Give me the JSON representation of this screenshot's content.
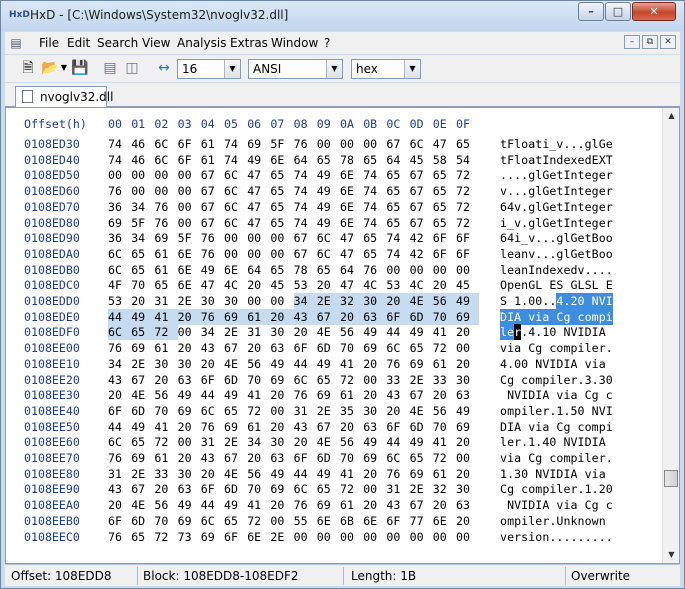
{
  "window": {
    "title": "HxD - [C:\\Windows\\System32\\nvoglv32.dll]",
    "app_icon": "HxD",
    "min": "–",
    "max": "□",
    "close": "✕"
  },
  "menu": {
    "items": [
      "File",
      "Edit",
      "Search",
      "View",
      "Analysis",
      "Extras",
      "Window",
      "?"
    ]
  },
  "toolbar": {
    "bytes_per_row": "16",
    "charset": "ANSI",
    "offset_base": "hex"
  },
  "tab": {
    "label": "nvoglv32.dll"
  },
  "editor": {
    "header_offset": "Offset(h)",
    "header_bytes": [
      "00",
      "01",
      "02",
      "03",
      "04",
      "05",
      "06",
      "07",
      "08",
      "09",
      "0A",
      "0B",
      "0C",
      "0D",
      "0E",
      "0F"
    ],
    "rows": [
      {
        "offset": "0108ED30",
        "bytes": "74 46 6C 6F 61 74 69 5F 76 00 00 00 67 6C 47 65",
        "text": "tFloati_v...glGe"
      },
      {
        "offset": "0108ED40",
        "bytes": "74 46 6C 6F 61 74 49 6E 64 65 78 65 64 45 58 54",
        "text": "tFloatIndexedEXT"
      },
      {
        "offset": "0108ED50",
        "bytes": "00 00 00 00 67 6C 47 65 74 49 6E 74 65 67 65 72",
        "text": "....glGetInteger"
      },
      {
        "offset": "0108ED60",
        "bytes": "76 00 00 00 67 6C 47 65 74 49 6E 74 65 67 65 72",
        "text": "v...glGetInteger"
      },
      {
        "offset": "0108ED70",
        "bytes": "36 34 76 00 67 6C 47 65 74 49 6E 74 65 67 65 72",
        "text": "64v.glGetInteger"
      },
      {
        "offset": "0108ED80",
        "bytes": "69 5F 76 00 67 6C 47 65 74 49 6E 74 65 67 65 72",
        "text": "i_v.glGetInteger"
      },
      {
        "offset": "0108ED90",
        "bytes": "36 34 69 5F 76 00 00 00 67 6C 47 65 74 42 6F 6F",
        "text": "64i_v...glGetBoo"
      },
      {
        "offset": "0108EDA0",
        "bytes": "6C 65 61 6E 76 00 00 00 67 6C 47 65 74 42 6F 6F",
        "text": "leanv...glGetBoo"
      },
      {
        "offset": "0108EDB0",
        "bytes": "6C 65 61 6E 49 6E 64 65 78 65 64 76 00 00 00 00",
        "text": "leanIndexedv...."
      },
      {
        "offset": "0108EDC0",
        "bytes": "4F 70 65 6E 47 4C 20 45 53 20 47 4C 53 4C 20 45",
        "text": "OpenGL ES GLSL E"
      },
      {
        "offset": "0108EDD0",
        "bytes": "53 20 31 2E 30 30 00 00 34 2E 32 30 20 4E 56 49",
        "text": "S 1.00..4.20 NVI"
      },
      {
        "offset": "0108EDE0",
        "bytes": "44 49 41 20 76 69 61 20 43 67 20 63 6F 6D 70 69",
        "text": "DIA via Cg compi"
      },
      {
        "offset": "0108EDF0",
        "bytes": "6C 65 72 00 34 2E 31 30 20 4E 56 49 44 49 41 20",
        "text": "ler.4.10 NVIDIA "
      },
      {
        "offset": "0108EE00",
        "bytes": "76 69 61 20 43 67 20 63 6F 6D 70 69 6C 65 72 00",
        "text": "via Cg compiler."
      },
      {
        "offset": "0108EE10",
        "bytes": "34 2E 30 30 20 4E 56 49 44 49 41 20 76 69 61 20",
        "text": "4.00 NVIDIA via "
      },
      {
        "offset": "0108EE20",
        "bytes": "43 67 20 63 6F 6D 70 69 6C 65 72 00 33 2E 33 30",
        "text": "Cg compiler.3.30"
      },
      {
        "offset": "0108EE30",
        "bytes": "20 4E 56 49 44 49 41 20 76 69 61 20 43 67 20 63",
        "text": " NVIDIA via Cg c"
      },
      {
        "offset": "0108EE40",
        "bytes": "6F 6D 70 69 6C 65 72 00 31 2E 35 30 20 4E 56 49",
        "text": "ompiler.1.50 NVI"
      },
      {
        "offset": "0108EE50",
        "bytes": "44 49 41 20 76 69 61 20 43 67 20 63 6F 6D 70 69",
        "text": "DIA via Cg compi"
      },
      {
        "offset": "0108EE60",
        "bytes": "6C 65 72 00 31 2E 34 30 20 4E 56 49 44 49 41 20",
        "text": "ler.1.40 NVIDIA "
      },
      {
        "offset": "0108EE70",
        "bytes": "76 69 61 20 43 67 20 63 6F 6D 70 69 6C 65 72 00",
        "text": "via Cg compiler."
      },
      {
        "offset": "0108EE80",
        "bytes": "31 2E 33 30 20 4E 56 49 44 49 41 20 76 69 61 20",
        "text": "1.30 NVIDIA via "
      },
      {
        "offset": "0108EE90",
        "bytes": "43 67 20 63 6F 6D 70 69 6C 65 72 00 31 2E 32 30",
        "text": "Cg compiler.1.20"
      },
      {
        "offset": "0108EEA0",
        "bytes": "20 4E 56 49 44 49 41 20 76 69 61 20 43 67 20 63",
        "text": " NVIDIA via Cg c"
      },
      {
        "offset": "0108EEB0",
        "bytes": "6F 6D 70 69 6C 65 72 00 55 6E 6B 6E 6F 77 6E 20",
        "text": "ompiler.Unknown "
      },
      {
        "offset": "0108EEC0",
        "bytes": "76 65 72 73 69 6F 6E 2E 00 00 00 00 00 00 00 00",
        "text": "version........."
      }
    ]
  },
  "status": {
    "offset": "Offset: 108EDD8",
    "block": "Block: 108EDD8-108EDF2",
    "length": "Length: 1B",
    "mode": "Overwrite"
  }
}
